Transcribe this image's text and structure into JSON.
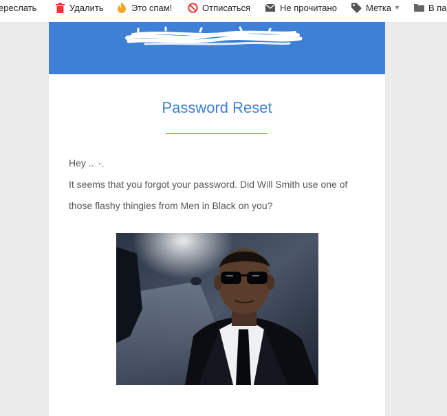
{
  "toolbar": {
    "items": [
      {
        "label": "ереслать",
        "icon": "forward-icon"
      },
      {
        "label": "Удалить",
        "icon": "trash-icon",
        "color": "#e53935"
      },
      {
        "label": "Это спам!",
        "icon": "fire-icon",
        "color": "#f5a623"
      },
      {
        "label": "Отписаться",
        "icon": "unsubscribe-icon",
        "color": "#e53935"
      },
      {
        "label": "Не прочитано",
        "icon": "envelope-icon"
      },
      {
        "label": "Метка",
        "icon": "tag-icon"
      },
      {
        "label": "В па",
        "icon": "folder-icon"
      }
    ]
  },
  "email": {
    "header_color": "#3d80d6",
    "logo_text": "",
    "title": "Password Reset",
    "greeting": "Hey .. ",
    "line1": "It seems that you forgot your password. Did Will Smith use one of",
    "line2": "those flashy thingies from Men in Black on you?",
    "image": "men-in-black-photo"
  }
}
